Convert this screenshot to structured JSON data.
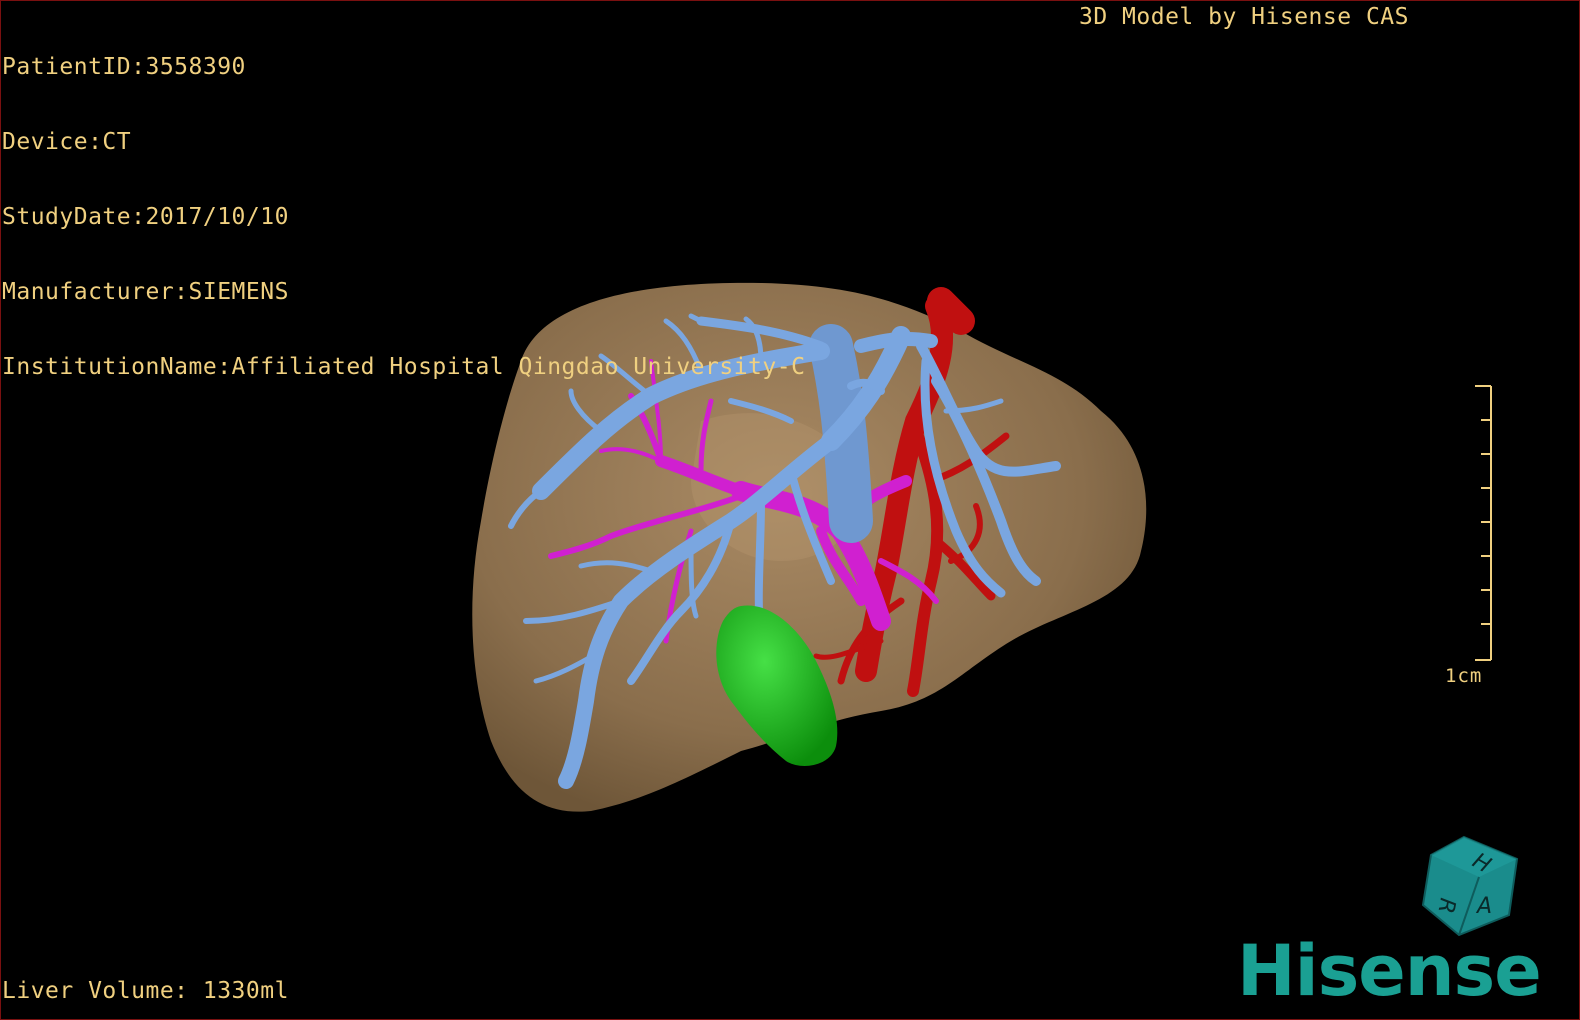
{
  "header": {
    "patient_id": "PatientID:3558390",
    "device": "Device:CT",
    "study_date": "StudyDate:2017/10/10",
    "manufacturer": "Manufacturer:SIEMENS",
    "institution": "InstitutionName:Affiliated Hospital Qingdao University-C"
  },
  "watermark": "3D Model by Hisense CAS",
  "footer": {
    "liver_volume": "Liver Volume: 1330ml"
  },
  "scale": {
    "label": "1cm"
  },
  "orientation_cube": {
    "labels": [
      "H",
      "R",
      "A"
    ],
    "color": "#1a8c8c"
  },
  "brand": {
    "logo_text": "Hisense",
    "color": "#1aa093"
  },
  "structures": {
    "liver": {
      "color": "#8a6e4c"
    },
    "hepatic_vein": {
      "color": "#7aa6e0"
    },
    "portal_vein": {
      "color": "#d020d0"
    },
    "artery": {
      "color": "#c01010"
    },
    "gallbladder": {
      "color": "#18b818"
    }
  }
}
